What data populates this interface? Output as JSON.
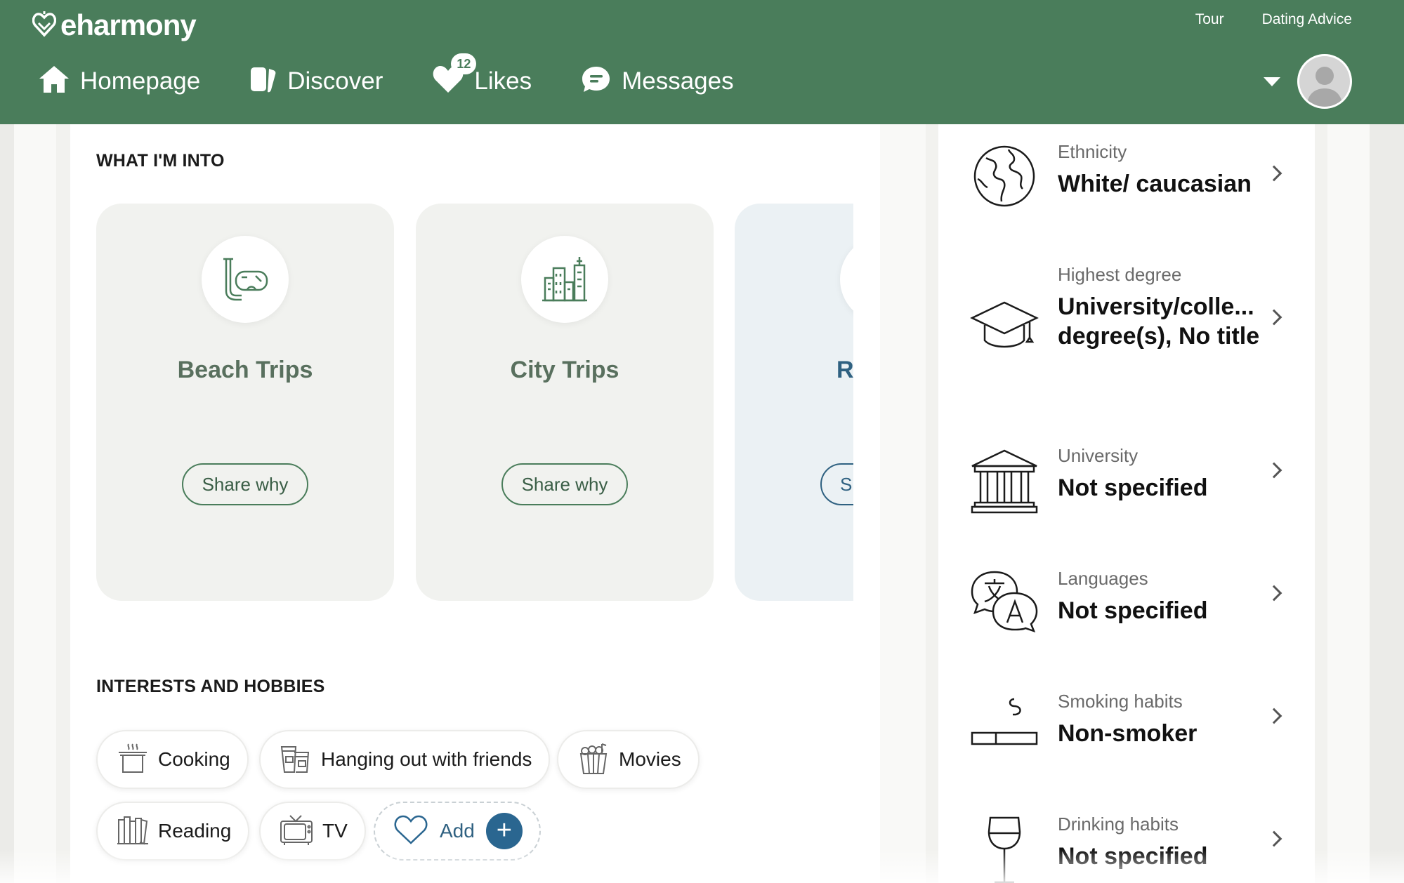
{
  "header": {
    "logo_text": "eharmony",
    "top_links": [
      "Tour",
      "Dating Advice"
    ],
    "nav": [
      {
        "label": "Homepage",
        "icon": "home-icon"
      },
      {
        "label": "Discover",
        "icon": "discover-cards-icon"
      },
      {
        "label": "Likes",
        "icon": "heart-icon",
        "badge": "12"
      },
      {
        "label": "Messages",
        "icon": "chat-bubble-icon"
      }
    ]
  },
  "what_im_into": {
    "title": "WHAT I'M INTO",
    "cards": [
      {
        "title": "Beach Trips",
        "icon": "snorkel-mask-icon",
        "button": "Share why"
      },
      {
        "title": "City Trips",
        "icon": "city-buildings-icon",
        "button": "Share why"
      },
      {
        "title": "R",
        "icon": "partial-icon",
        "button": "Sh"
      }
    ]
  },
  "interests": {
    "title": "INTERESTS AND HOBBIES",
    "chips": [
      {
        "label": "Cooking",
        "icon": "cooking-pot-icon"
      },
      {
        "label": "Hanging out with friends",
        "icon": "drinks-icon"
      },
      {
        "label": "Movies",
        "icon": "popcorn-icon"
      },
      {
        "label": "Reading",
        "icon": "books-icon"
      },
      {
        "label": "TV",
        "icon": "tv-icon"
      }
    ],
    "add_label": "Add",
    "add_symbol": "+"
  },
  "details": [
    {
      "label": "Ethnicity",
      "value": "White/ caucasian",
      "icon": "globe-icon"
    },
    {
      "label": "Highest degree",
      "value": "University/colle... degree(s), No title",
      "icon": "graduation-cap-icon"
    },
    {
      "label": "University",
      "value": "Not specified",
      "icon": "university-building-icon"
    },
    {
      "label": "Languages",
      "value": "Not specified",
      "icon": "languages-icon"
    },
    {
      "label": "Smoking habits",
      "value": "Non-smoker",
      "icon": "cigarette-icon"
    },
    {
      "label": "Drinking habits",
      "value": "Not specified",
      "icon": "wine-glass-icon"
    }
  ],
  "colors": {
    "brand_green": "#4a7d5b",
    "accent_blue": "#2a6690",
    "card_gray": "#f1f2ef"
  }
}
